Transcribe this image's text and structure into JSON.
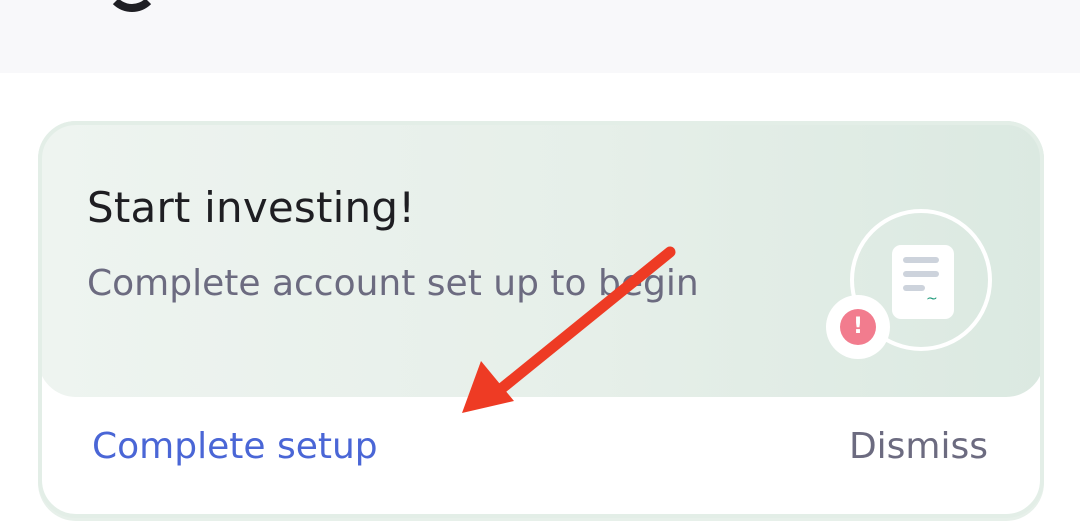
{
  "card": {
    "title": "Start investing!",
    "subtitle": "Complete account set up to begin",
    "alert_symbol": "!",
    "signature_glyph": "~",
    "actions": {
      "primary_label": "Complete setup",
      "secondary_label": "Dismiss"
    }
  },
  "icons": {
    "document": "document-icon",
    "alert": "alert-icon",
    "annotation": "red-arrow-annotation"
  },
  "colors": {
    "primary_action": "#4a66d6",
    "secondary_text": "#6c6b80",
    "alert": "#f27c8e",
    "arrow": "#ee3b24"
  }
}
